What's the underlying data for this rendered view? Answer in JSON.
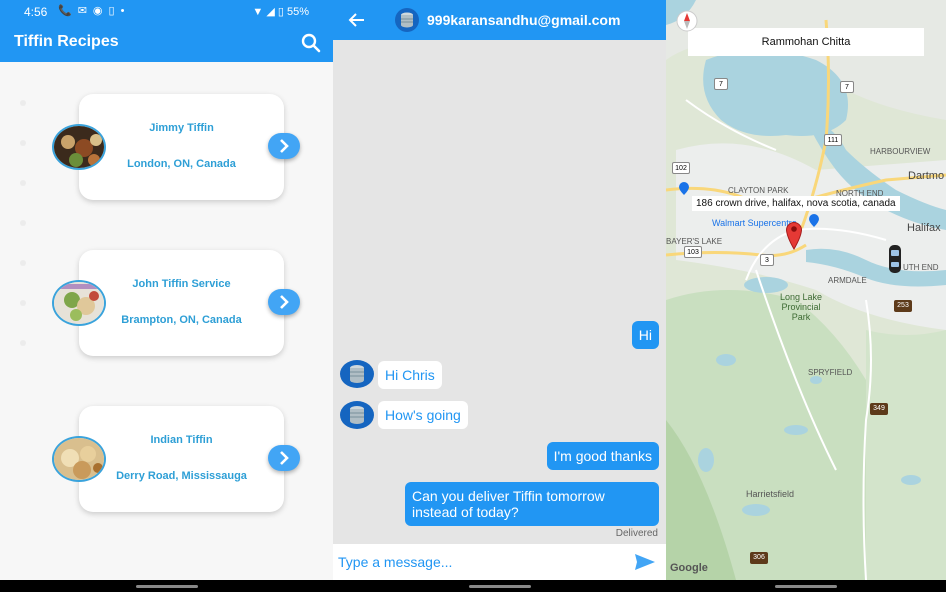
{
  "status": {
    "time": "4:56",
    "battery": "55%"
  },
  "list": {
    "title": "Tiffin Recipes",
    "items": [
      {
        "name": "Jimmy Tiffin",
        "location": "London, ON, Canada"
      },
      {
        "name": "John Tiffin Service",
        "location": "Brampton, ON, Canada"
      },
      {
        "name": "Indian Tiffin",
        "location": "Derry Road, Mississauga"
      }
    ]
  },
  "chat": {
    "contact": "999karansandhu@gmail.com",
    "messages": [
      {
        "text": "Hi",
        "direction": "out"
      },
      {
        "text": "Hi Chris",
        "direction": "in"
      },
      {
        "text": "How's going",
        "direction": "in"
      },
      {
        "text": "I'm good thanks",
        "direction": "out"
      },
      {
        "text": "Can you deliver Tiffin tomorrow instead of today?",
        "direction": "out"
      }
    ],
    "status": "Delivered",
    "placeholder": "Type a message..."
  },
  "map": {
    "search_value": "Rammohan Chitta",
    "address": "186 crown drive, halifax, nova scotia, canada",
    "labels": {
      "harbourview": "HARBOURVIEW",
      "dartmouth": "Dartmo",
      "clayton": "CLAYTON PARK",
      "northend": "NORTH END",
      "walmart": "Walmart Supercentre",
      "halifax": "Halifax",
      "bayers": "BAYER'S LAKE",
      "armdale": "ARMDALE",
      "southend": "UTH END",
      "longlake": "Long Lake Provincial Park",
      "spryfield": "SPRYFIELD",
      "harrietsfield": "Harrietsfield"
    },
    "road_shields": [
      "7",
      "7",
      "111",
      "102",
      "102",
      "103",
      "3",
      "253",
      "349",
      "306"
    ],
    "attribution": "Google"
  },
  "colors": {
    "primary": "#2196f3",
    "card_text": "#2e9fd6"
  }
}
